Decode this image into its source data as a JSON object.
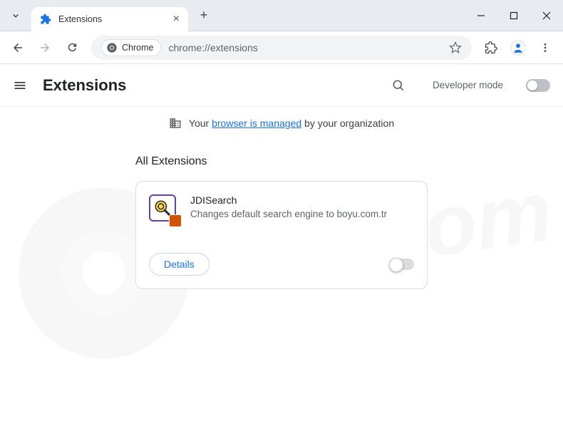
{
  "window": {
    "tab_title": "Extensions"
  },
  "toolbar": {
    "chip_label": "Chrome",
    "url": "chrome://extensions"
  },
  "header": {
    "title": "Extensions",
    "dev_mode_label": "Developer mode"
  },
  "banner": {
    "prefix": "Your ",
    "link": "browser is managed",
    "suffix": " by your organization"
  },
  "section": {
    "title": "All Extensions"
  },
  "extension": {
    "name": "JDISearch",
    "description": "Changes default search engine to boyu.com.tr",
    "details_label": "Details"
  }
}
